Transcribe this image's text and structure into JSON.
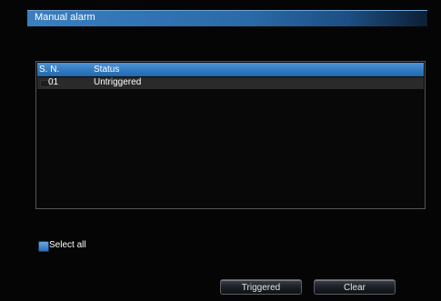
{
  "window": {
    "title": "Manual  alarm"
  },
  "list": {
    "columns": {
      "sn": "S. N.",
      "status": "Status"
    },
    "rows": [
      {
        "sn": "01",
        "status": "Untriggered"
      }
    ]
  },
  "select_all": {
    "label": "Select  all"
  },
  "buttons": {
    "triggered": "Triggered",
    "clear": "Clear"
  },
  "colors": {
    "accent": "#2e78c0",
    "title_bar": "#3a7fc0"
  }
}
